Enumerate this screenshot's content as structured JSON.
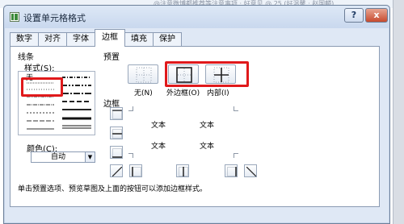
{
  "background": {
    "strip_text": "@注意微博都推荐等注意事项 · 好意见 @ 25 (好温馨 · 赵国麟)"
  },
  "window": {
    "title": "设置单元格格式",
    "help_label": "?",
    "close_label": "x"
  },
  "tabs": [
    {
      "label": "数字"
    },
    {
      "label": "对齐"
    },
    {
      "label": "字体"
    },
    {
      "label": "边框"
    },
    {
      "label": "填充"
    },
    {
      "label": "保护"
    }
  ],
  "active_tab": "边框",
  "line": {
    "group_label": "线条",
    "style_label": "样式(S):",
    "none_label": "无",
    "color_label": "颜色(C):",
    "color_value": "自动"
  },
  "presets": {
    "group_label": "预置",
    "none_label": "无(N)",
    "outline_label": "外边框(O)",
    "inside_label": "内部(I)"
  },
  "border": {
    "group_label": "边框",
    "preview_text": [
      "文本",
      "文本",
      "文本",
      "文本"
    ]
  },
  "hint": "单击预置选项、预览草图及上面的按钮可以添加边框样式。",
  "colors": {
    "highlight": "#e0191b",
    "dialog_bg": "#dfe8f5",
    "panel_bg": "#ffffff"
  }
}
